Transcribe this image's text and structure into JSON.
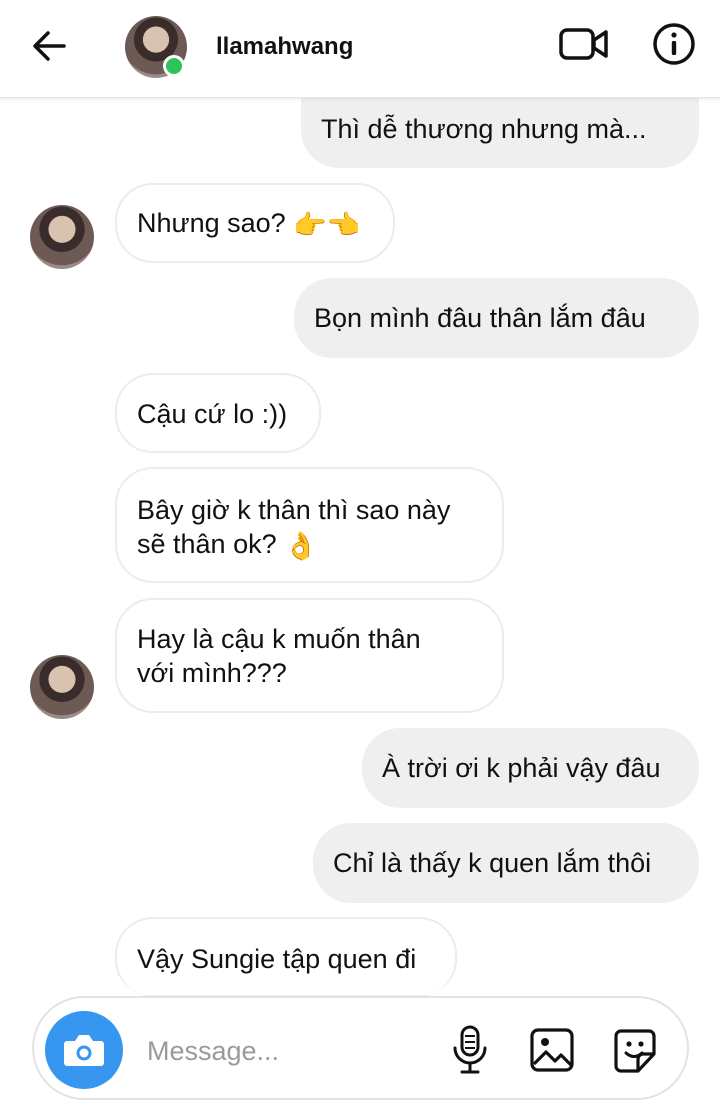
{
  "header": {
    "username": "llamahwang",
    "icons": {
      "back": "arrow-left-icon",
      "video": "video-camera-icon",
      "info": "info-icon",
      "status": "online-status-dot"
    },
    "status_color": "#2ec45a"
  },
  "messages": [
    {
      "sender": "me",
      "text": "Thì dễ thương nhưng mà..."
    },
    {
      "sender": "them",
      "text": "Nhưng sao?",
      "emoji": "👉👈"
    },
    {
      "sender": "me",
      "text": "Bọn mình đâu thân lắm đâu"
    },
    {
      "sender": "them",
      "text": "Cậu cứ lo :))"
    },
    {
      "sender": "them",
      "lines": [
        "Bây giờ k thân thì sao này",
        "sẽ thân ok?"
      ],
      "emoji": "👌"
    },
    {
      "sender": "them",
      "lines": [
        "Hay là cậu k muốn thân",
        "với mình???"
      ]
    },
    {
      "sender": "me",
      "text": "À trời ơi k phải vậy đâu"
    },
    {
      "sender": "me",
      "text": "Chỉ là thấy k quen lắm thôi"
    },
    {
      "sender": "them",
      "text": "Vậy Sungie tập quen đi"
    }
  ],
  "composer": {
    "placeholder": "Message...",
    "accent_color": "#3797f0",
    "icons": [
      "camera-icon",
      "microphone-icon",
      "gallery-icon",
      "sticker-icon"
    ]
  }
}
